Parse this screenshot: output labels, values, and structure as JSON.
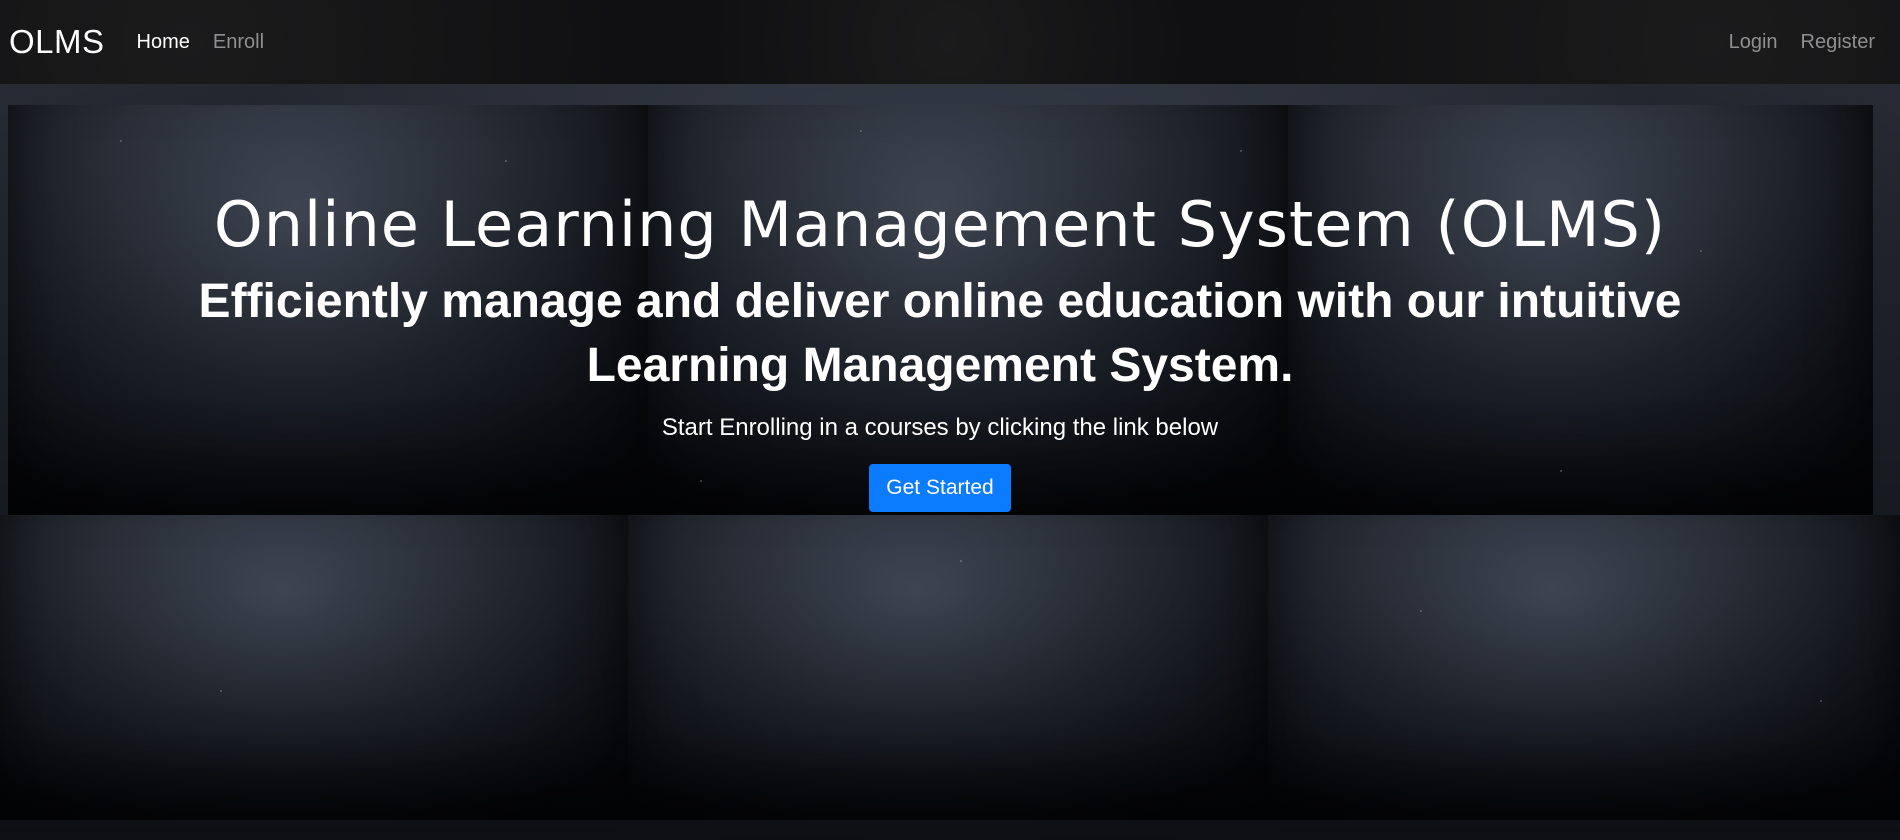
{
  "navbar": {
    "brand": "OLMS",
    "links_left": [
      {
        "label": "Home",
        "active": true
      },
      {
        "label": "Enroll",
        "active": false
      }
    ],
    "links_right": [
      {
        "label": "Login"
      },
      {
        "label": "Register"
      }
    ]
  },
  "hero": {
    "title": "Online Learning Management System (OLMS)",
    "subtitle": "Efficiently manage and deliver online education with our intuitive Learning Management System.",
    "lead": "Start Enrolling in a courses by clicking the link below",
    "cta_label": "Get Started"
  },
  "colors": {
    "primary_button": "#0b7bff",
    "navbar_bg": "#0e0e10",
    "text": "#ffffff",
    "muted_link": "#8f8f8f"
  }
}
